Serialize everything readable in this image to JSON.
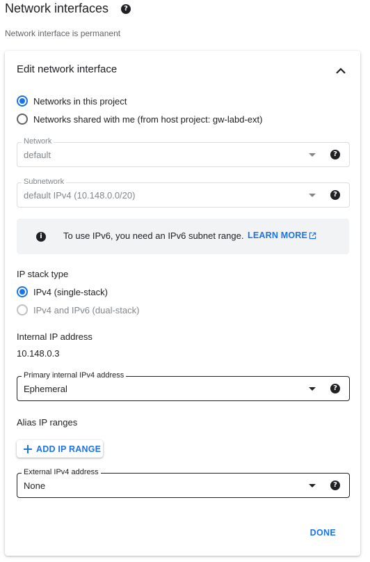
{
  "page": {
    "title": "Network interfaces",
    "subtitle": "Network interface is permanent"
  },
  "card": {
    "title": "Edit network interface",
    "network_source": {
      "options": [
        {
          "label": "Networks in this project",
          "checked": true
        },
        {
          "label": "Networks shared with me (from host project: gw-labd-ext)",
          "checked": false
        }
      ]
    },
    "network": {
      "label": "Network",
      "value": "default"
    },
    "subnetwork": {
      "label": "Subnetwork",
      "value": "default IPv4 (10.148.0.0/20)"
    },
    "ipv6_banner": {
      "text": "To use IPv6, you need an IPv6 subnet range.",
      "link": "LEARN MORE"
    },
    "ip_stack": {
      "label": "IP stack type",
      "options": [
        {
          "label": "IPv4 (single-stack)",
          "checked": true
        },
        {
          "label": "IPv4 and IPv6 (dual-stack)",
          "checked": false,
          "disabled": true
        }
      ]
    },
    "internal_ip": {
      "label": "Internal IP address",
      "value": "10.148.0.3"
    },
    "primary_internal_ipv4": {
      "label": "Primary internal IPv4 address",
      "value": "Ephemeral"
    },
    "alias_ip": {
      "label": "Alias IP ranges",
      "button": "ADD IP RANGE"
    },
    "external_ipv4": {
      "label": "External IPv4 address",
      "value": "None"
    },
    "done": "DONE"
  },
  "colors": {
    "accent": "#1a73e8",
    "text": "#202124",
    "muted": "#80868b",
    "banner_bg": "#f1f3f4"
  },
  "icons": [
    "help-icon",
    "chevron-up-icon",
    "info-icon",
    "external-link-icon",
    "plus-icon",
    "dropdown-arrow-icon"
  ]
}
